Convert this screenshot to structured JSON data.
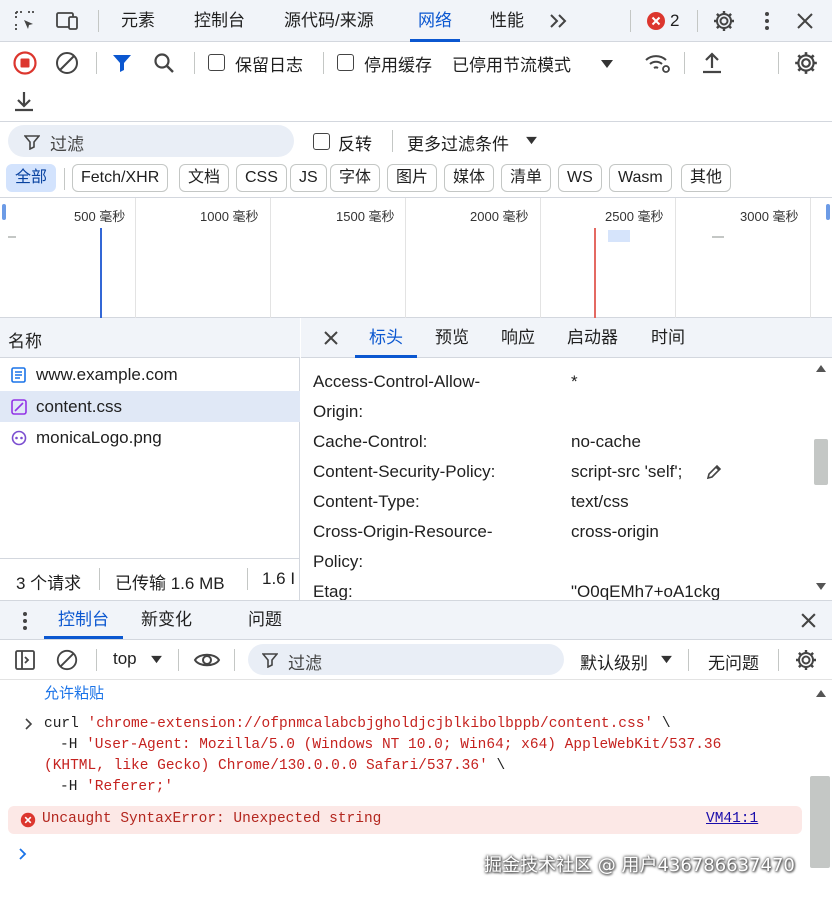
{
  "top_tabs": {
    "items": [
      "元素",
      "控制台",
      "源代码/来源",
      "网络",
      "性能"
    ],
    "active": "网络",
    "more": "»",
    "error_count": "2"
  },
  "network_toolbar": {
    "preserve_log": "保留日志",
    "disable_cache": "停用缓存",
    "throttle": "已停用节流模式"
  },
  "filter": {
    "placeholder": "过滤",
    "invert": "反转",
    "more_filters": "更多过滤条件"
  },
  "type_filters": [
    "全部",
    "Fetch/XHR",
    "文档",
    "CSS",
    "JS",
    "字体",
    "图片",
    "媒体",
    "清单",
    "WS",
    "Wasm",
    "其他"
  ],
  "timeline": {
    "ticks": [
      "500 毫秒",
      "1000 毫秒",
      "1500 毫秒",
      "2000 毫秒",
      "2500 毫秒",
      "3000 毫秒"
    ]
  },
  "request_list": {
    "header": "名称",
    "items": [
      {
        "name": "www.example.com",
        "icon": "document-icon"
      },
      {
        "name": "content.css",
        "icon": "css-icon"
      },
      {
        "name": "monicaLogo.png",
        "icon": "image-icon"
      }
    ],
    "status": {
      "requests": "3 个请求",
      "transferred": "已传输 1.6 MB",
      "truncated": "1.6 I"
    }
  },
  "details": {
    "tabs": [
      "标头",
      "预览",
      "响应",
      "启动器",
      "时间"
    ],
    "active": "标头",
    "headers": [
      {
        "key": "Access-Control-Allow-",
        "key2": "Origin:",
        "value": "*"
      },
      {
        "key": "Cache-Control:",
        "value": "no-cache"
      },
      {
        "key": "Content-Security-Policy:",
        "value": "script-src 'self';"
      },
      {
        "key": "Content-Type:",
        "value": "text/css"
      },
      {
        "key": "Cross-Origin-Resource-",
        "key2": "Policy:",
        "value": "cross-origin"
      },
      {
        "key": "Etag:",
        "value": "\"O0qEMh7+oA1ckg"
      }
    ]
  },
  "drawer": {
    "tabs": [
      "控制台",
      "新变化",
      "问题"
    ],
    "active": "控制台"
  },
  "console_toolbar": {
    "context": "top",
    "filter_placeholder": "过滤",
    "level": "默认级别",
    "issues": "无问题"
  },
  "console": {
    "allow_paste": "允许粘贴",
    "curl_cmd": "curl",
    "curl_url": "'chrome-extension://ofpnmcalabcbjgholdjcjblkibolbppb/content.css'",
    "curl_cont": "\\",
    "h_flag": "-H",
    "user_agent_1": "'User-Agent: Mozilla/5.0 (Windows NT 10.0; Win64; x64) AppleWebKit/537.36",
    "user_agent_2": "(KHTML, like Gecko) Chrome/130.0.0.0 Safari/537.36'",
    "referer": "'Referer;'",
    "error_text": "Uncaught SyntaxError: Unexpected string",
    "error_source": "VM41:1"
  },
  "watermark": "掘金技术社区 @ 用户436786637470"
}
